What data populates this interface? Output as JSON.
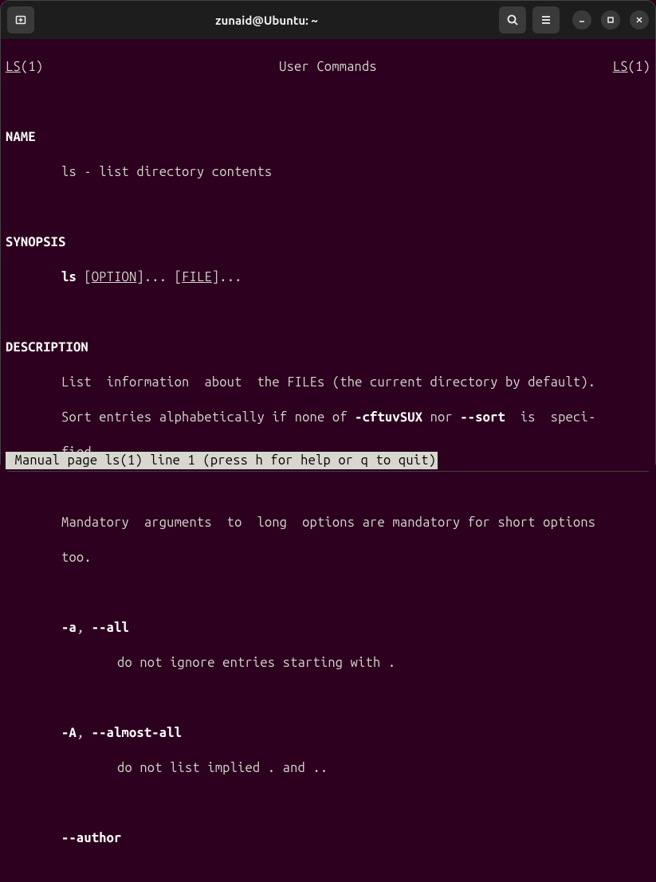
{
  "titlebar": {
    "title": "zunaid@Ubuntu: ~"
  },
  "man": {
    "header_left": "LS",
    "header_left_section": "(1)",
    "header_center": "User Commands",
    "header_right": "LS",
    "header_right_section": "(1)",
    "section_name": "NAME",
    "name_line": "ls - list directory contents",
    "section_synopsis": "SYNOPSIS",
    "synopsis_cmd": "ls",
    "synopsis_option": "OPTION",
    "synopsis_file": "FILE",
    "synopsis_open": " [",
    "synopsis_close": "]... [",
    "synopsis_end": "]...",
    "section_description": "DESCRIPTION",
    "desc_line1": "List  information  about  the FILEs (the current directory by default).",
    "desc_line2a": "Sort entries alphabetically if none of ",
    "desc_line2_flag1": "-cftuvSUX",
    "desc_line2b": " nor ",
    "desc_line2_flag2": "--sort",
    "desc_line2c": "  is  speci‐",
    "desc_line3": "fied.",
    "desc_line4": "Mandatory  arguments  to  long  options are mandatory for short options",
    "desc_line5": "too.",
    "opt_a": "-a",
    "opt_a_sep": ", ",
    "opt_all": "--all",
    "opt_a_desc": "do not ignore entries starting with .",
    "opt_A": "-A",
    "opt_A_sep": ", ",
    "opt_almost": "--almost-all",
    "opt_A_desc": "do not list implied . and ..",
    "opt_author": "--author",
    "statusbar": " Manual page ls(1) line 1 (press h for help or q to quit)"
  }
}
